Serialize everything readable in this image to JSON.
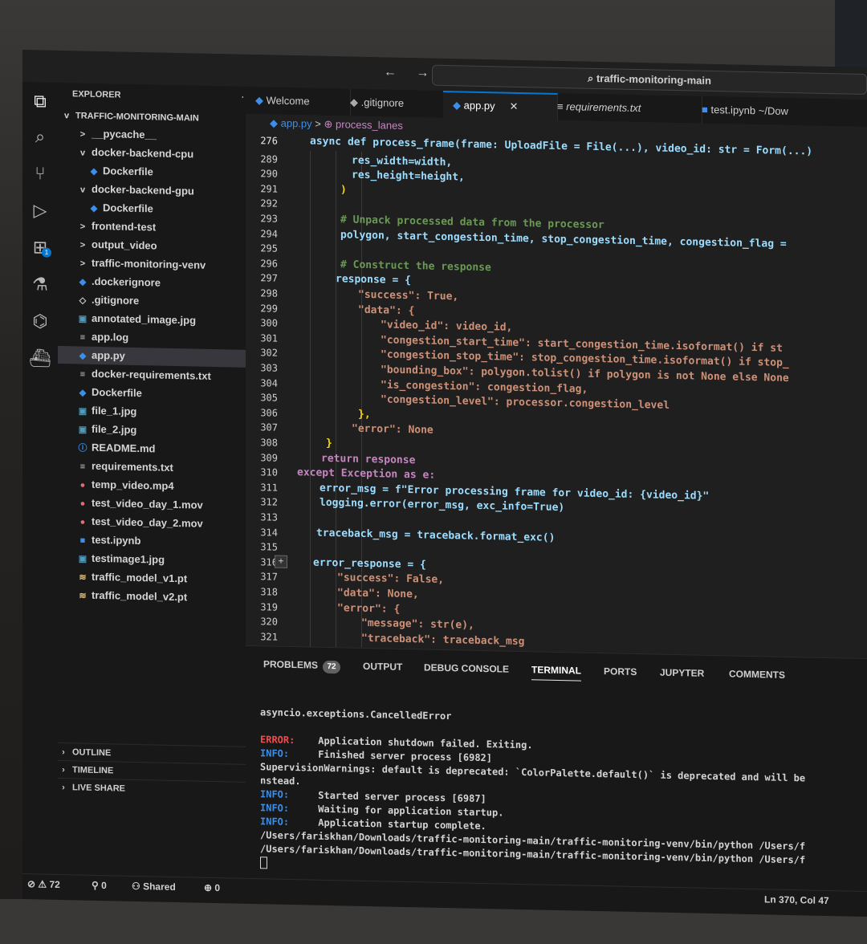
{
  "titlebar": {
    "nav": "← →",
    "command_center": "⌕ traffic-monitoring-main"
  },
  "activity": [
    {
      "name": "explorer-icon",
      "glyph": "⧉"
    },
    {
      "name": "search-icon",
      "glyph": "⌕"
    },
    {
      "name": "source-control-icon",
      "glyph": "⑂"
    },
    {
      "name": "run-debug-icon",
      "glyph": "▷"
    },
    {
      "name": "extensions-icon",
      "glyph": "⊞"
    },
    {
      "name": "testing-icon",
      "glyph": "⚗"
    },
    {
      "name": "remote-explorer-icon",
      "glyph": "⌬"
    },
    {
      "name": "docker-icon",
      "glyph": "⛴"
    }
  ],
  "explorer": {
    "title": "EXPLORER",
    "more": "···",
    "root": "TRAFFIC-MONITORING-MAIN",
    "items": [
      {
        "label": "__pycache__",
        "icon": ">",
        "level": 1
      },
      {
        "label": "docker-backend-cpu",
        "icon": "v",
        "level": 1
      },
      {
        "label": "Dockerfile",
        "icon": "◆",
        "level": 2
      },
      {
        "label": "docker-backend-gpu",
        "icon": "v",
        "level": 1
      },
      {
        "label": "Dockerfile",
        "icon": "◆",
        "level": 2
      },
      {
        "label": "frontend-test",
        "icon": ">",
        "level": 1
      },
      {
        "label": "output_video",
        "icon": ">",
        "level": 1
      },
      {
        "label": "traffic-monitoring-venv",
        "icon": ">",
        "level": 1
      },
      {
        "label": ".dockerignore",
        "icon": "◆",
        "level": 1
      },
      {
        "label": ".gitignore",
        "icon": "◇",
        "level": 1
      },
      {
        "label": "annotated_image.jpg",
        "icon": "▣",
        "level": 1
      },
      {
        "label": "app.log",
        "icon": "≡",
        "level": 1
      },
      {
        "label": "app.py",
        "icon": "◆",
        "level": 1,
        "selected": true
      },
      {
        "label": "docker-requirements.txt",
        "icon": "≡",
        "level": 1
      },
      {
        "label": "Dockerfile",
        "icon": "◆",
        "level": 1
      },
      {
        "label": "file_1.jpg",
        "icon": "▣",
        "level": 1
      },
      {
        "label": "file_2.jpg",
        "icon": "▣",
        "level": 1
      },
      {
        "label": "README.md",
        "icon": "ⓘ",
        "level": 1
      },
      {
        "label": "requirements.txt",
        "icon": "≡",
        "level": 1
      },
      {
        "label": "temp_video.mp4",
        "icon": "●",
        "level": 1
      },
      {
        "label": "test_video_day_1.mov",
        "icon": "●",
        "level": 1
      },
      {
        "label": "test_video_day_2.mov",
        "icon": "●",
        "level": 1
      },
      {
        "label": "test.ipynb",
        "icon": "■",
        "level": 1
      },
      {
        "label": "testimage1.jpg",
        "icon": "▣",
        "level": 1
      },
      {
        "label": "traffic_model_v1.pt",
        "icon": "≋",
        "level": 1
      },
      {
        "label": "traffic_model_v2.pt",
        "icon": "≋",
        "level": 1
      }
    ],
    "sections": [
      "OUTLINE",
      "TIMELINE",
      "LIVE SHARE"
    ]
  },
  "tabs": [
    {
      "label": "Welcome",
      "icon": "◆",
      "active": false
    },
    {
      "label": ".gitignore",
      "icon": "◆",
      "active": false
    },
    {
      "label": "app.py",
      "icon": "◆",
      "active": true,
      "close": "✕"
    },
    {
      "label": "requirements.txt",
      "icon": "≡",
      "active": false
    },
    {
      "label": "test.ipynb ~/Dow",
      "icon": "■",
      "active": false
    }
  ],
  "breadcrumb": {
    "file": "◆ app.py",
    "sep": ">",
    "symbol": "⊕ process_lanes"
  },
  "editor": {
    "line_numbers": [
      "276",
      "289",
      "290",
      "291",
      "292",
      "293",
      "294",
      "295",
      "296",
      "297",
      "298",
      "299",
      "300",
      "301",
      "302",
      "303",
      "304",
      "305",
      "306",
      "307",
      "308",
      "309",
      "310",
      "311",
      "312",
      "313",
      "314",
      "315",
      "316",
      "317",
      "318",
      "319",
      "320",
      "321"
    ],
    "sticky_line": "async def process_frame(frame: UploadFile = File(...), video_id: str = Form(...)",
    "lines": [
      "res_width=width,",
      "res_height=height,",
      ")",
      "",
      "# Unpack processed data from the processor",
      "polygon, start_congestion_time, stop_congestion_time, congestion_flag =",
      "",
      "# Construct the response",
      "response = {",
      "\"success\": True,",
      "\"data\": {",
      "\"video_id\": video_id,",
      "\"congestion_start_time\": start_congestion_time.isoformat() if st",
      "\"congestion_stop_time\": stop_congestion_time.isoformat() if stop_",
      "\"bounding_box\": polygon.tolist() if polygon is not None else None",
      "\"is_congestion\": congestion_flag,",
      "\"congestion_level\": processor.congestion_level",
      "},",
      "\"error\": None",
      "}",
      "return response",
      "except Exception as e:",
      "error_msg = f\"Error processing frame for video_id: {video_id}\"",
      "logging.error(error_msg, exc_info=True)",
      "",
      "traceback_msg = traceback.format_exc()",
      "",
      "error_response = {",
      "\"success\": False,",
      "\"data\": None,",
      "\"error\": {",
      "\"message\": str(e),",
      "\"traceback\": traceback_msg"
    ],
    "fold_button": "+"
  },
  "panel": {
    "tabs": [
      "PROBLEMS",
      "OUTPUT",
      "DEBUG CONSOLE",
      "TERMINAL",
      "PORTS",
      "JUPYTER",
      "COMMENTS"
    ],
    "problems_count": "72",
    "active_tab": "TERMINAL",
    "terminal": [
      {
        "level": "",
        "text": "asyncio.exceptions.CancelledError"
      },
      {
        "level": "",
        "text": ""
      },
      {
        "level": "ERROR:",
        "text": "    Application shutdown failed. Exiting."
      },
      {
        "level": "INFO:",
        "text": "     Finished server process [6982]"
      },
      {
        "level": "",
        "text": "SupervisionWarnings: default is deprecated: `ColorPalette.default()` is deprecated and will be"
      },
      {
        "level": "",
        "text": "nstead."
      },
      {
        "level": "INFO:",
        "text": "     Started server process [6987]"
      },
      {
        "level": "INFO:",
        "text": "     Waiting for application startup."
      },
      {
        "level": "INFO:",
        "text": "     Application startup complete."
      },
      {
        "level": "",
        "text": "/Users/fariskhan/Downloads/traffic-monitoring-main/traffic-monitoring-venv/bin/python /Users/f"
      },
      {
        "level": "",
        "text": "/Users/fariskhan/Downloads/traffic-monitoring-main/traffic-monitoring-venv/bin/python /Users/f"
      }
    ]
  },
  "statusbar": {
    "problems": "⊘ ⚠ 72",
    "ports": "⚲ 0",
    "share": "⚇ Shared",
    "notifications": "⊕ 0",
    "cursor": "Ln 370, Col 47"
  }
}
